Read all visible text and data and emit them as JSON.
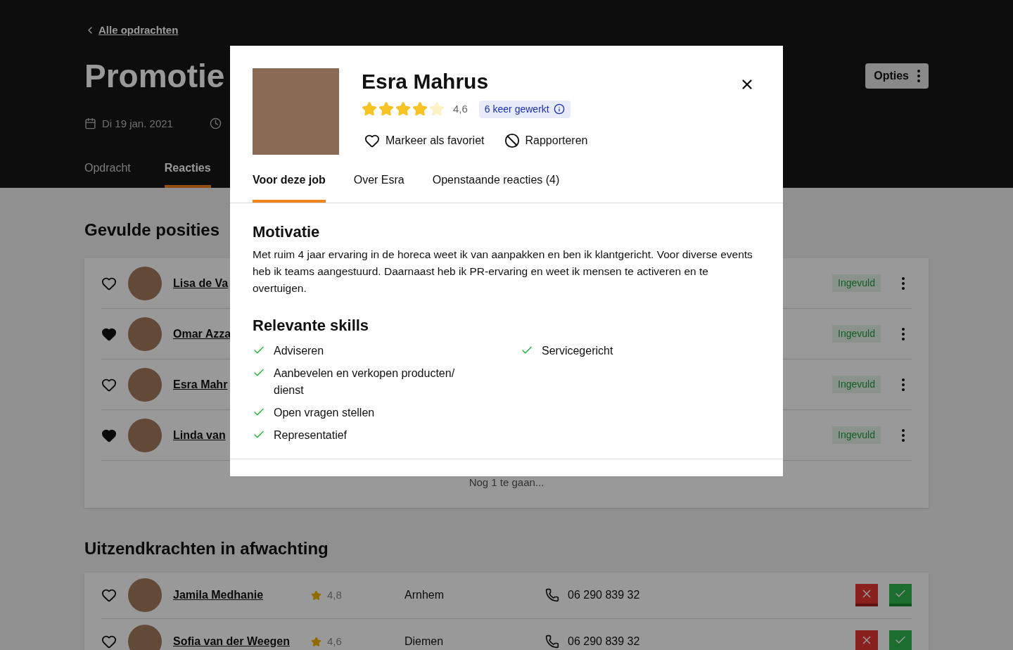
{
  "header": {
    "back_link": "Alle opdrachten",
    "title": "Promotie",
    "date": "Di 19 jan. 2021",
    "options_button": "Opties",
    "tabs": [
      {
        "label": "Opdracht",
        "selected": false
      },
      {
        "label": "Reacties",
        "selected": true
      }
    ]
  },
  "filled_section": {
    "title": "Gevulde posities",
    "rows": [
      {
        "name": "Lisa de Va",
        "favorite": false,
        "status": "Ingevuld"
      },
      {
        "name": "Omar Azza",
        "favorite": true,
        "status": "Ingevuld"
      },
      {
        "name": "Esra Mahr",
        "favorite": false,
        "status": "Ingevuld"
      },
      {
        "name": "Linda van",
        "favorite": true,
        "status": "Ingevuld"
      }
    ],
    "footer": "Nog 1 te gaan..."
  },
  "pending_section": {
    "title": "Uitzendkrachten in afwachting",
    "rows": [
      {
        "name": "Jamila Medhanie",
        "favorite": false,
        "rating": "4,8",
        "city": "Arnhem",
        "phone": "06 290 839 32"
      },
      {
        "name": "Sofia van der Weegen",
        "favorite": false,
        "rating": "4,6",
        "city": "Diemen",
        "phone": "06 290 839 32"
      }
    ]
  },
  "modal": {
    "name": "Esra Mahrus",
    "stars": 4,
    "rating": "4,6",
    "worked_badge": "6 keer gewerkt",
    "favorite_action": "Markeer als favoriet",
    "report_action": "Rapporteren",
    "tabs": [
      {
        "label": "Voor deze job",
        "selected": true
      },
      {
        "label": "Over Esra",
        "selected": false
      },
      {
        "label": "Openstaande reacties (4)",
        "selected": false
      }
    ],
    "motivation_title": "Motivatie",
    "motivation": "Met ruim 4 jaar ervaring in de horeca weet ik van aanpakken en ben ik klantgericht. Voor diverse events heb ik teams aangestuurd. Daarnaast heb ik PR-ervaring en weet ik mensen te activeren en te overtuigen.",
    "skills_title": "Relevante skills",
    "skills_left": [
      "Adviseren",
      "Aanbevelen en verkopen producten/ dienst",
      "Open vragen stellen",
      "Representatief"
    ],
    "skills_right": [
      "Servicegericht"
    ]
  }
}
